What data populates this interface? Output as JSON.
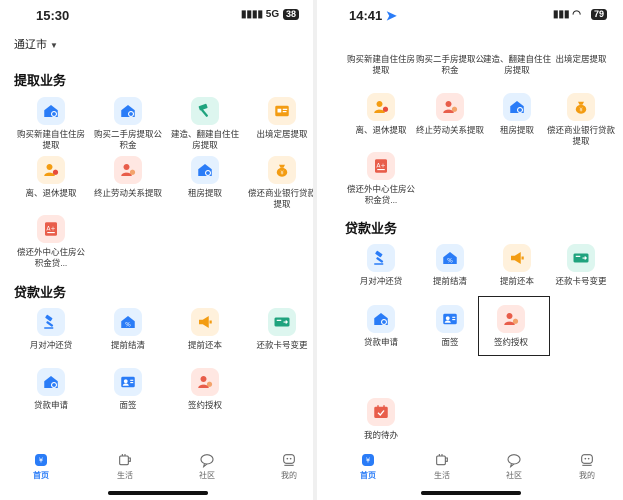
{
  "left": {
    "status": {
      "time": "15:30",
      "signal": "5G",
      "battery": "38"
    },
    "city": "通辽市",
    "sections": {
      "withdraw": {
        "title": "提取业务",
        "items": [
          "购买新建自住住房提取",
          "购买二手房提取公积金",
          "建造、翻建自住住房提取",
          "出境定居提取",
          "离、退休提取",
          "终止劳动关系提取",
          "租房提取",
          "偿还商业银行贷款提取",
          "偿还外中心住房公积金贷..."
        ]
      },
      "loan": {
        "title": "贷款业务",
        "items": [
          "月对冲还贷",
          "提前结清",
          "提前还本",
          "还款卡号变更",
          "贷款申请",
          "面签",
          "签约授权"
        ]
      }
    },
    "tabs": [
      "首页",
      "生活",
      "社区",
      "我的"
    ]
  },
  "right": {
    "status": {
      "time": "14:41",
      "battery": "79"
    },
    "withdraw_items": [
      "购买新建自住住房提取",
      "购买二手房提取公积金",
      "建造、翻建自住住房提取",
      "出境定居提取",
      "离、退休提取",
      "终止劳动关系提取",
      "租房提取",
      "偿还商业银行贷款提取",
      "偿还外中心住房公积金贷..."
    ],
    "loan_title": "贷款业务",
    "loan_items": [
      "月对冲还贷",
      "提前结清",
      "提前还本",
      "还款卡号变更",
      "贷款申请",
      "面签",
      "签约授权"
    ],
    "todo": "我的待办",
    "tabs": [
      "首页",
      "生活",
      "社区",
      "我的"
    ]
  },
  "colors": {
    "accent": "#2a7cf7",
    "blue_bg": "#e4f1ff",
    "green_bg": "#ddf6ef",
    "orange_bg": "#fff1dc",
    "red_bg": "#ffe7e2"
  }
}
